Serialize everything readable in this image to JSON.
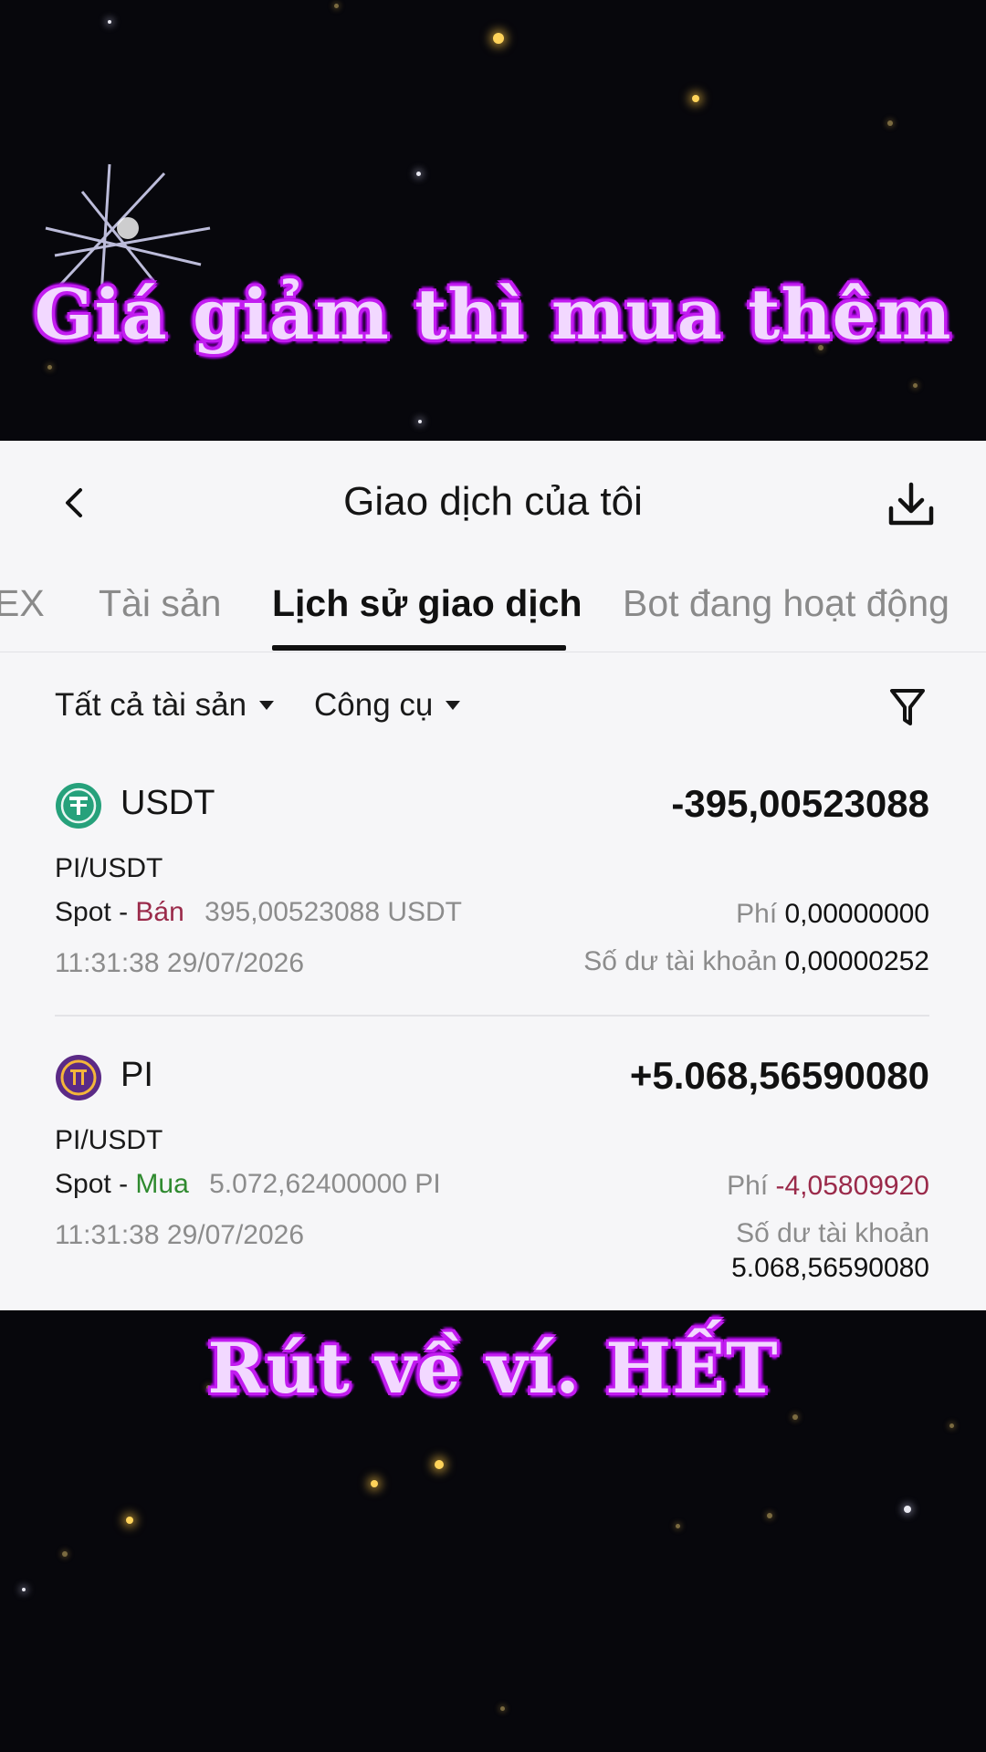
{
  "captions": {
    "top": "Giá giảm thì mua thêm",
    "bottom": "Rút về ví. HẾT"
  },
  "header": {
    "title": "Giao dịch của tôi",
    "back_icon": "chevron-left-icon",
    "download_icon": "download-icon"
  },
  "tabs": [
    {
      "label": "EX",
      "active": false
    },
    {
      "label": "Tài sản",
      "active": false
    },
    {
      "label": "Lịch sử giao dịch",
      "active": true
    },
    {
      "label": "Bot đang hoạt động",
      "active": false
    }
  ],
  "filters": {
    "assets": "Tất cả tài sản",
    "tools": "Công cụ",
    "filter_icon": "funnel-icon"
  },
  "transactions": [
    {
      "coin": "USDT",
      "icon": "tether-icon",
      "icon_color": "#26a17b",
      "amount": "-395,00523088",
      "pair": "PI/USDT",
      "type": "Spot",
      "separator": "-",
      "side": "Bán",
      "quantity": "395,00523088 USDT",
      "time": "11:31:38 29/07/2026",
      "fee_label": "Phí",
      "fee_value": "0,00000000",
      "balance_label": "Số dư tài khoản",
      "balance_value": "0,00000252"
    },
    {
      "coin": "PI",
      "icon": "pi-network-icon",
      "icon_color": "#5b2a86",
      "amount": "+5.068,56590080",
      "pair": "PI/USDT",
      "type": "Spot",
      "separator": "-",
      "side": "Mua",
      "quantity": "5.072,62400000 PI",
      "time": "11:31:38 29/07/2026",
      "fee_label": "Phí",
      "fee_value": "-4,05809920",
      "balance_label": "Số dư tài khoản",
      "balance_value": "5.068,56590080"
    }
  ]
}
